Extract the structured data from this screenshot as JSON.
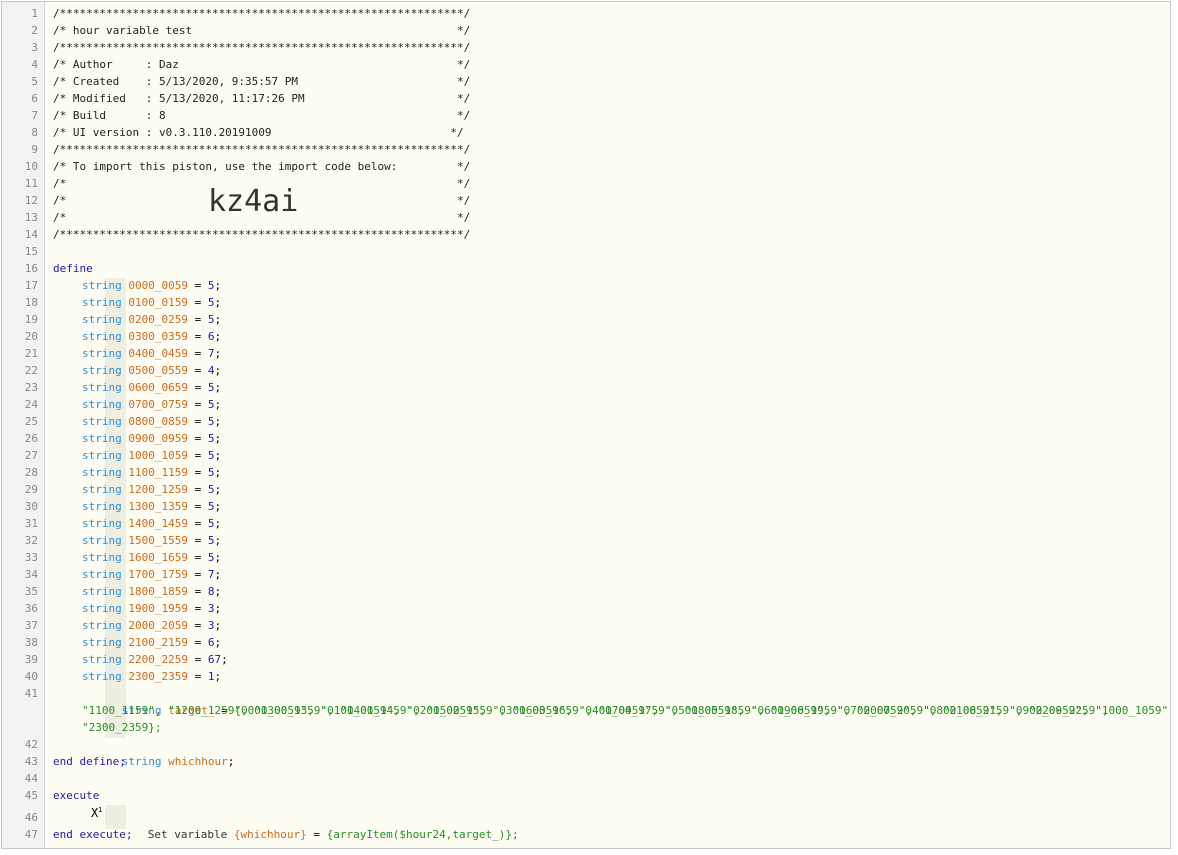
{
  "header": {
    "rule": "/*************************************************************/",
    "title_line": "/* hour variable test                                        */",
    "author_line": "/* Author     : Daz                                          */",
    "created_line": "/* Created    : 5/13/2020, 9:35:57 PM                        */",
    "modified_line": "/* Modified   : 5/13/2020, 11:17:26 PM                       */",
    "build_line": "/* Build      : 8                                            */",
    "ui_line": "/* UI version : v0.3.110.20191009                           */",
    "import_line": "/* To import this piston, use the import code below:         */",
    "empty_line": "/*                                                           */",
    "import_code": "kz4ai"
  },
  "line_numbers": [
    "1",
    "2",
    "3",
    "4",
    "5",
    "6",
    "7",
    "8",
    "9",
    "10",
    "11",
    "12",
    "13",
    "14",
    "15",
    "16",
    "17",
    "18",
    "19",
    "20",
    "21",
    "22",
    "23",
    "24",
    "25",
    "26",
    "27",
    "28",
    "29",
    "30",
    "31",
    "32",
    "33",
    "34",
    "35",
    "36",
    "37",
    "38",
    "39",
    "40",
    "41",
    "42",
    "43",
    "44",
    "45",
    "46",
    "47"
  ],
  "keywords": {
    "define": "define",
    "end_define": "end define;",
    "execute": "execute",
    "end_execute": "end execute;",
    "string_type": "string",
    "equals": "=",
    "semicolon": ";"
  },
  "variables": [
    {
      "name": "0000_0059",
      "value": "5"
    },
    {
      "name": "0100_0159",
      "value": "5"
    },
    {
      "name": "0200_0259",
      "value": "5"
    },
    {
      "name": "0300_0359",
      "value": "6"
    },
    {
      "name": "0400_0459",
      "value": "7"
    },
    {
      "name": "0500_0559",
      "value": "4"
    },
    {
      "name": "0600_0659",
      "value": "5"
    },
    {
      "name": "0700_0759",
      "value": "5"
    },
    {
      "name": "0800_0859",
      "value": "5"
    },
    {
      "name": "0900_0959",
      "value": "5"
    },
    {
      "name": "1000_1059",
      "value": "5"
    },
    {
      "name": "1100_1159",
      "value": "5"
    },
    {
      "name": "1200_1259",
      "value": "5"
    },
    {
      "name": "1300_1359",
      "value": "5"
    },
    {
      "name": "1400_1459",
      "value": "5"
    },
    {
      "name": "1500_1559",
      "value": "5"
    },
    {
      "name": "1600_1659",
      "value": "5"
    },
    {
      "name": "1700_1759",
      "value": "7"
    },
    {
      "name": "1800_1859",
      "value": "8"
    },
    {
      "name": "1900_1959",
      "value": "3"
    },
    {
      "name": "2000_2059",
      "value": "3"
    },
    {
      "name": "2100_2159",
      "value": "6"
    },
    {
      "name": "2200_2259",
      "value": "67"
    },
    {
      "name": "2300_2359",
      "value": "1"
    }
  ],
  "target": {
    "name": "target_",
    "line1": "{0000_0059\", \"0100_0159\", \"0200_0259\", \"0300_0359\", \"0400_0459\", \"0500_0559\", \"0600_0659\", \"0700_0759\", \"0800_0859\", \"0900_0959\", \"1000_1059\",",
    "line2": "\"1100_1159\", \"1200_1259\", \"1300_1359\", \"1400_1459\", \"1500_1559\", \"1600_1659\", \"1700_1759\", \"1800_1859\", \"1900_1959\", \"2000_2059\", \"2100_2159\", \"2200_2259\",",
    "line3": "\"2300_2359};"
  },
  "whichhour": {
    "name": "whichhour"
  },
  "task": {
    "icon_label": "X",
    "icon_sup": "1",
    "prefix": "Set variable ",
    "variable": "{whichhour}",
    "equals": " = ",
    "expression": "{arrayItem($hour24,target_)};"
  }
}
